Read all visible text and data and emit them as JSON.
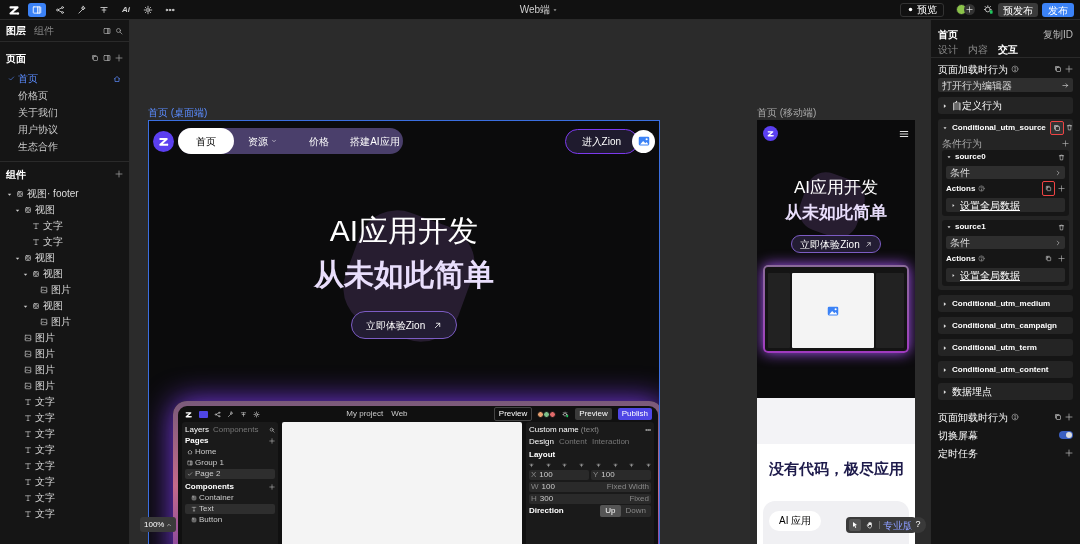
{
  "top_bar": {
    "tools": [
      {
        "selected": false
      },
      {
        "selected": true
      },
      {
        "selected": false
      },
      {
        "selected": false
      },
      {
        "selected": false
      },
      {
        "label": "Ai",
        "selected": false
      },
      {
        "selected": false
      },
      {
        "selected": false
      }
    ],
    "title": "Web端",
    "preview": "预览",
    "pre_publish": "预发布",
    "publish": "发布"
  },
  "left_panel": {
    "tabs": [
      {
        "label": "图层",
        "selected": true
      },
      {
        "label": "组件",
        "selected": false
      }
    ],
    "pages_title": "页面",
    "pages": [
      {
        "label": "首页",
        "selected": true
      },
      {
        "label": "价格页",
        "selected": false
      },
      {
        "label": "关于我们",
        "selected": false
      },
      {
        "label": "用户协议",
        "selected": false
      },
      {
        "label": "生态合作",
        "selected": false
      }
    ],
    "components_title": "组件",
    "tree": [
      {
        "kind": "view",
        "label": "视图· footer",
        "expanded": true,
        "children": [
          {
            "kind": "view",
            "label": "视图",
            "expanded": true,
            "children": [
              {
                "kind": "text",
                "label": "文字"
              },
              {
                "kind": "text",
                "label": "文字"
              }
            ]
          },
          {
            "kind": "view",
            "label": "视图",
            "expanded": true,
            "children": [
              {
                "kind": "view",
                "label": "视图",
                "expanded": true,
                "children": [
                  {
                    "kind": "image",
                    "label": "图片"
                  }
                ]
              },
              {
                "kind": "view",
                "label": "视图",
                "expanded": true,
                "children": [
                  {
                    "kind": "image",
                    "label": "图片"
                  }
                ]
              }
            ]
          },
          {
            "kind": "image",
            "label": "图片"
          },
          {
            "kind": "image",
            "label": "图片"
          },
          {
            "kind": "image",
            "label": "图片"
          },
          {
            "kind": "image",
            "label": "图片"
          },
          {
            "kind": "text",
            "label": "文字"
          },
          {
            "kind": "text",
            "label": "文字"
          },
          {
            "kind": "text",
            "label": "文字"
          },
          {
            "kind": "text",
            "label": "文字"
          },
          {
            "kind": "text",
            "label": "文字"
          },
          {
            "kind": "text",
            "label": "文字"
          },
          {
            "kind": "text",
            "label": "文字"
          },
          {
            "kind": "text",
            "label": "文字"
          }
        ]
      }
    ]
  },
  "canvas": {
    "desktop": {
      "label": "首页 (桌面端)",
      "nav": [
        {
          "label": "首页",
          "selected": true,
          "dropdown": false
        },
        {
          "label": "资源",
          "selected": false,
          "dropdown": true
        },
        {
          "label": "价格",
          "selected": false,
          "dropdown": false
        },
        {
          "label": "搭建AI应用",
          "selected": false,
          "dropdown": false
        }
      ],
      "cta": "进入Zion",
      "headline": "AI应用开发",
      "headline_bold": "从未如此简单",
      "button": "立即体验Zion",
      "mockup": {
        "project": "My project",
        "env": "Web",
        "preview_small": "Preview",
        "preview": "Preview",
        "publish": "Publish",
        "tabs": [
          {
            "label": "Layers",
            "selected": true
          },
          {
            "label": "Components",
            "selected": false
          }
        ],
        "pages_title": "Pages",
        "pages": [
          {
            "label": "Home",
            "selected": false
          },
          {
            "label": "Group 1",
            "selected": false
          },
          {
            "label": "Page 2",
            "selected": true
          }
        ],
        "components_title": "Components",
        "components": [
          {
            "label": "Container",
            "selected": false
          },
          {
            "label": "Text",
            "selected": true
          },
          {
            "label": "Button",
            "selected": false
          }
        ],
        "panel_title": "Custom name",
        "panel_tag": "(text)",
        "panel_tabs": [
          {
            "label": "Design",
            "selected": true
          },
          {
            "label": "Content",
            "selected": false
          },
          {
            "label": "Interaction",
            "selected": false
          }
        ],
        "layout_title": "Layout",
        "fields": [
          {
            "label": "X",
            "value": "100"
          },
          {
            "label": "Y",
            "value": "100"
          },
          {
            "label": "W",
            "value": "100",
            "mode": "Fixed Width"
          },
          {
            "label": "H",
            "value": "300",
            "mode": "Fixed"
          }
        ],
        "direction_title": "Direction",
        "direction_options": [
          {
            "label": "Up",
            "selected": true
          },
          {
            "label": "Down",
            "selected": false
          }
        ]
      }
    },
    "mobile": {
      "label": "首页 (移动端)",
      "headline": "AI应用开发",
      "headline_bold": "从未如此简单",
      "button": "立即体验Zion",
      "section_title": "没有代码，极尽应用",
      "chip": "AI 应用"
    },
    "zoom": "100%",
    "tools": [
      {
        "selected": true
      },
      {
        "selected": false
      }
    ],
    "plan": "专业版",
    "help": "?"
  },
  "right_panel": {
    "title": "首页",
    "copy_id": "复制ID",
    "tabs": [
      {
        "label": "设计",
        "selected": false
      },
      {
        "label": "内容",
        "selected": false
      },
      {
        "label": "交互",
        "selected": true
      }
    ],
    "load_title": "页面加载时行为",
    "editor_button": "打开行为编辑器",
    "behaviors": [
      {
        "label": "自定义行为",
        "expanded": false
      },
      {
        "label": "Conditional_utm_source",
        "expanded": true,
        "highlighted": true,
        "subtitle": "条件行为",
        "branches": [
          {
            "name": "source0",
            "condition": "条件",
            "actions_label": "Actions",
            "highlighted": true,
            "actions": [
              "设置全局数据"
            ]
          },
          {
            "name": "source1",
            "condition": "条件",
            "actions_label": "Actions",
            "highlighted": false,
            "actions": [
              "设置全局数据"
            ]
          }
        ]
      },
      {
        "label": "Conditional_utm_medium",
        "expanded": false
      },
      {
        "label": "Conditional_utm_campaign",
        "expanded": false
      },
      {
        "label": "Conditional_utm_term",
        "expanded": false
      },
      {
        "label": "Conditional_utm_content",
        "expanded": false
      },
      {
        "label": "数据埋点",
        "expanded": false
      }
    ],
    "unload_title": "页面卸载时行为",
    "switch": {
      "label": "切换屏幕",
      "on": true
    },
    "timer_title": "定时任务"
  }
}
